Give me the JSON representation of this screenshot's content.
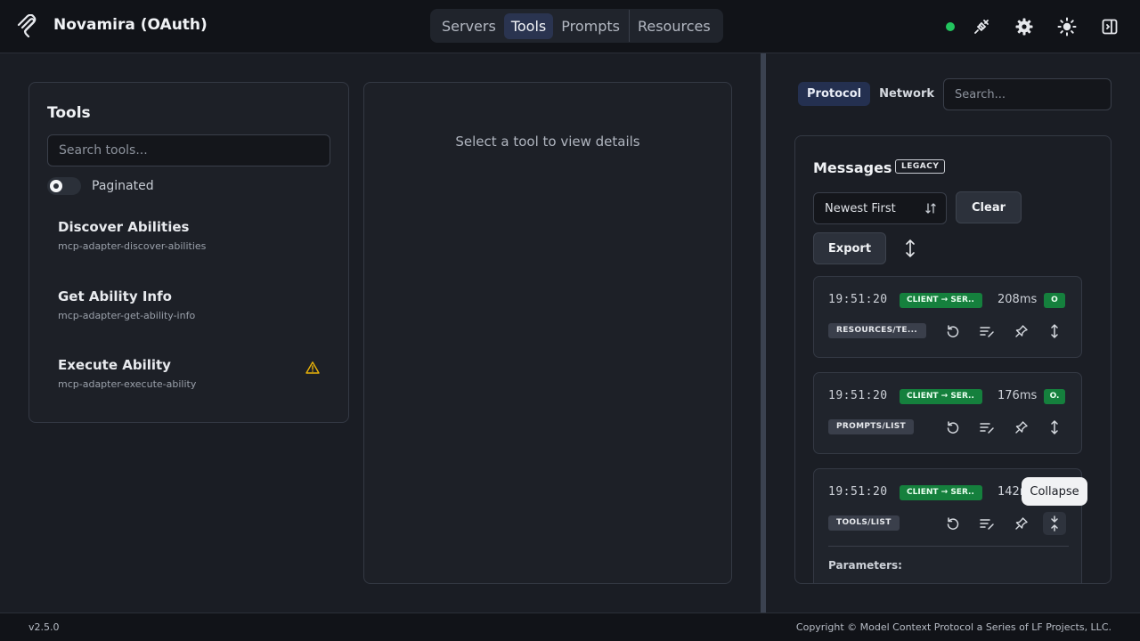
{
  "header": {
    "title": "Novamira (OAuth)",
    "logo_icon": "mcp-logo-icon",
    "nav_tabs": [
      {
        "label": "Servers",
        "active": false
      },
      {
        "label": "Tools",
        "active": true
      },
      {
        "label": "Prompts",
        "active": false
      },
      {
        "label": "Resources",
        "active": false
      }
    ],
    "status_color": "#22c55e",
    "icons": [
      "connection-plug-icon",
      "gear-icon",
      "sun-icon",
      "sidebar-toggle-icon"
    ]
  },
  "tools": {
    "title": "Tools",
    "search_placeholder": "Search tools...",
    "toggle_label": "Paginated",
    "paginated": false,
    "items": [
      {
        "name": "Discover Abilities",
        "id": "mcp-adapter-discover-abilities",
        "warning": false
      },
      {
        "name": "Get Ability Info",
        "id": "mcp-adapter-get-ability-info",
        "warning": false
      },
      {
        "name": "Execute Ability",
        "id": "mcp-adapter-execute-ability",
        "warning": true
      }
    ]
  },
  "detail": {
    "empty_text": "Select a tool to view details"
  },
  "right": {
    "tabs": [
      {
        "label": "Protocol",
        "active": true
      },
      {
        "label": "Network",
        "active": false
      }
    ],
    "search_placeholder": "Search...",
    "messages": {
      "title": "Messages",
      "badge": "LEGACY",
      "sort_value": "Newest First",
      "clear_label": "Clear",
      "export_label": "Export",
      "cards": [
        {
          "time": "19:51:20",
          "direction": "CLIENT → SER..",
          "duration": "208ms",
          "status": "O",
          "method": "RESOURCES/TE..."
        },
        {
          "time": "19:51:20",
          "direction": "CLIENT → SER..",
          "duration": "176ms",
          "status": "O.",
          "method": "PROMPTS/LIST"
        },
        {
          "time": "19:51:20",
          "direction": "CLIENT → SER..",
          "duration": "142r",
          "status": "",
          "method": "TOOLS/LIST",
          "expanded": true,
          "params_label": "Parameters:"
        }
      ]
    },
    "tooltip": "Collapse"
  },
  "footer": {
    "version": "v2.5.0",
    "copyright": "Copyright © Model Context Protocol a Series of LF Projects, LLC."
  },
  "colors": {
    "accent_green": "#15803d",
    "active_tab_bg": "#2a3450",
    "warning": "#eab308"
  }
}
